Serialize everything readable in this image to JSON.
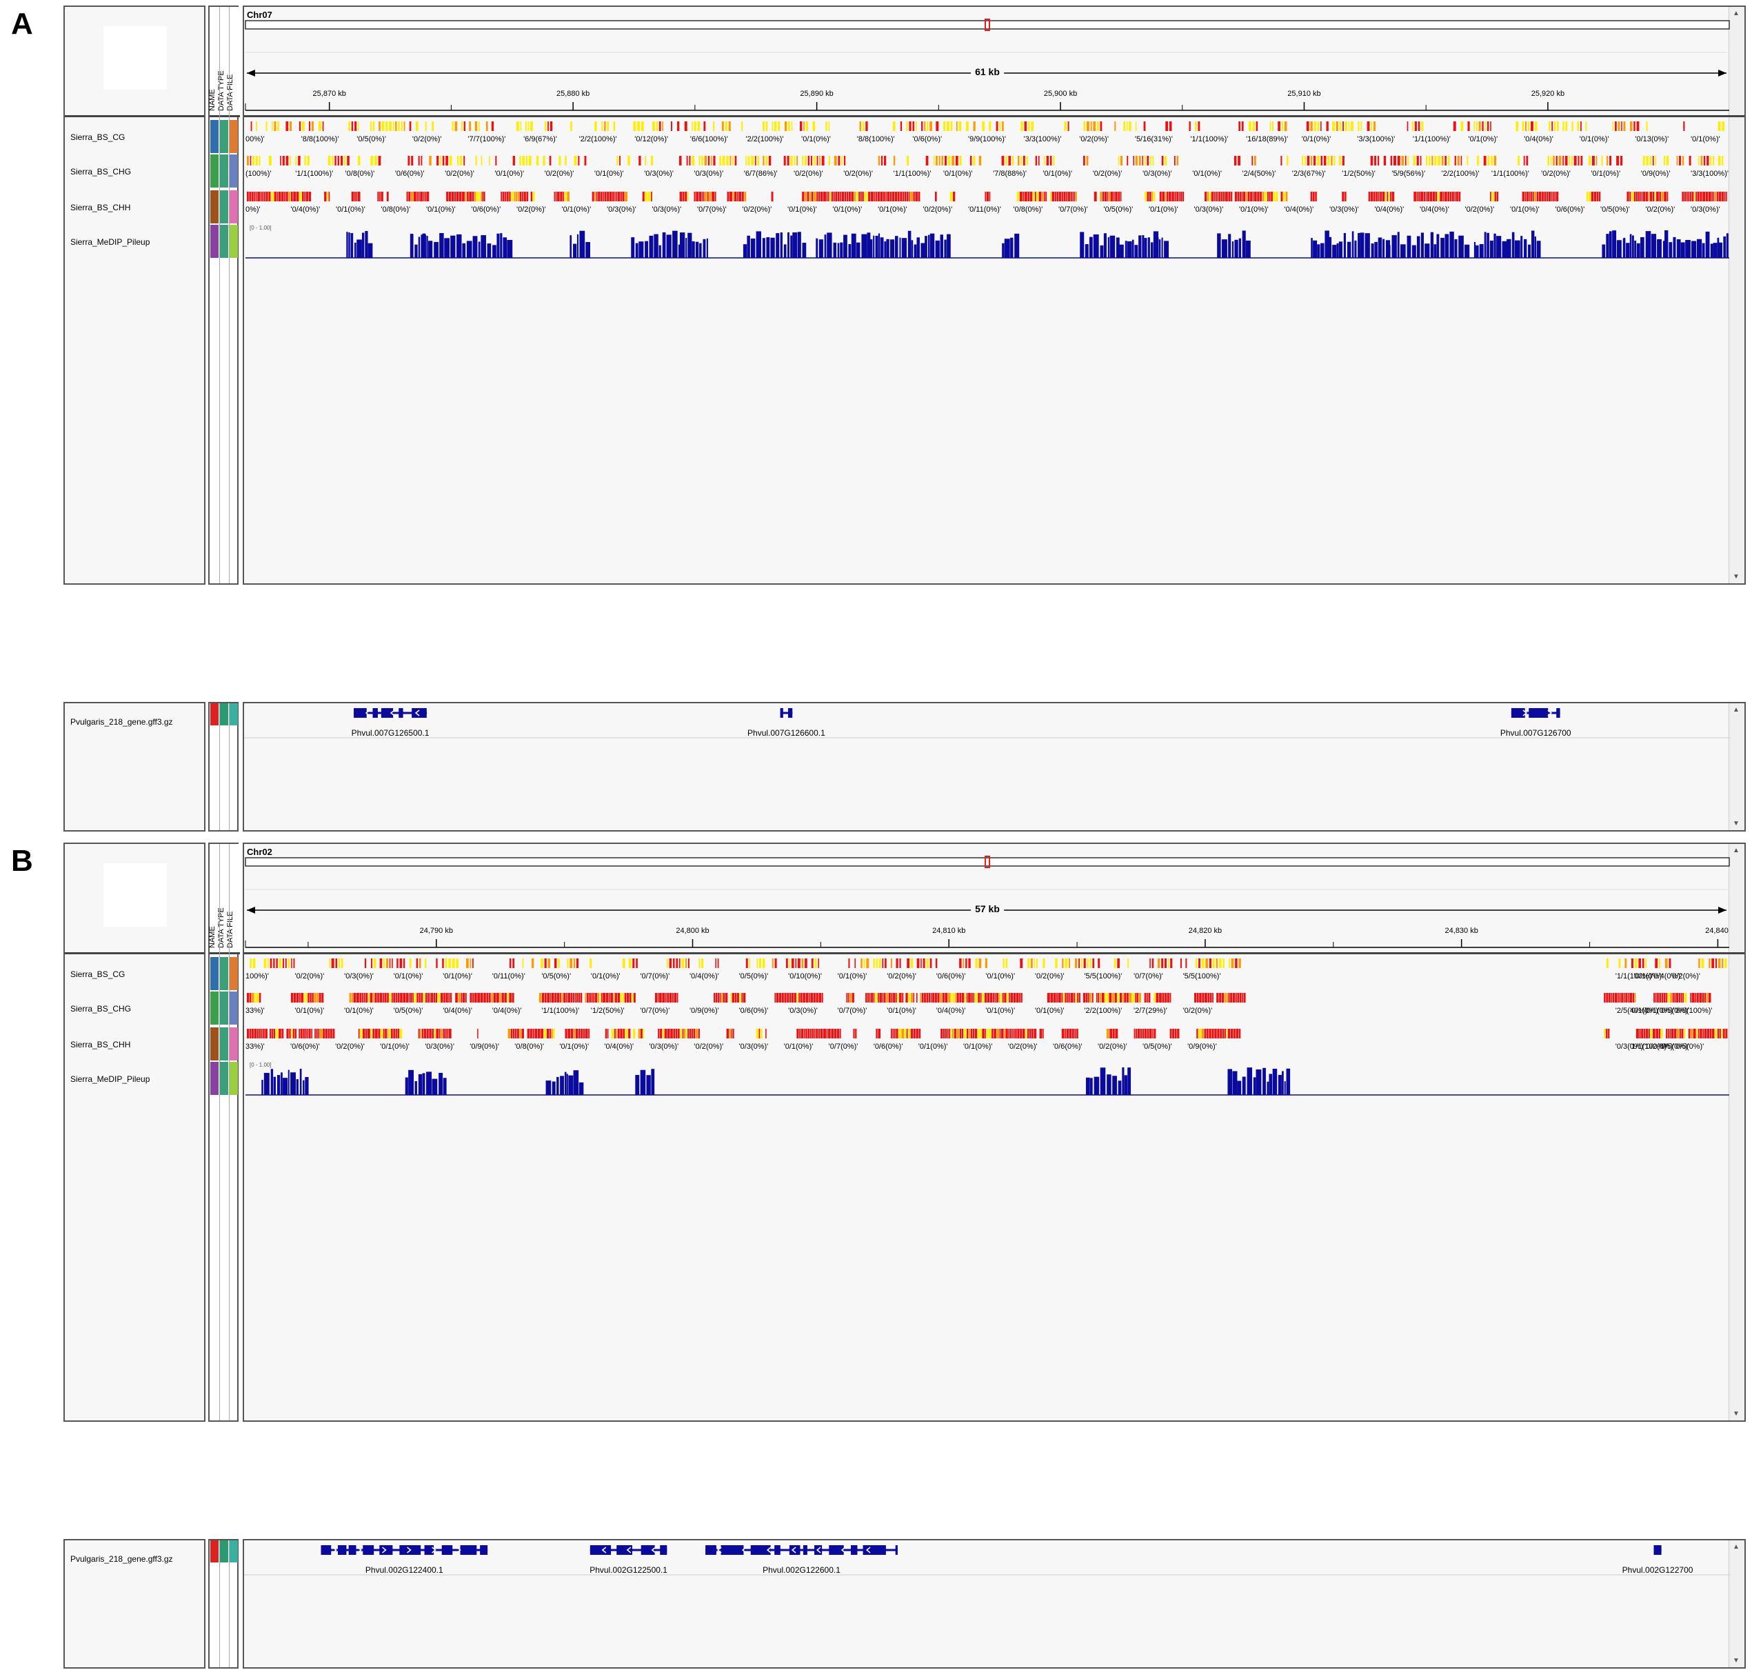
{
  "attr_headers": [
    "NAME",
    "DATA TYPE",
    "DATA FILE"
  ],
  "colors": {
    "meth_high": "#ee1111",
    "meth_mid": "#ff9900",
    "meth_low": "#ffee00",
    "pileup": "#0a0a9e",
    "gene": "#0a0a9e",
    "roi": "#e02020"
  },
  "panels": [
    {
      "letter": "A",
      "chromosome": "Chr07",
      "span_label": "61 kb",
      "range_kb": [
        25866.5,
        25927.5
      ],
      "roi_position_kb": 25897.0,
      "ticks": [
        {
          "kb": 25870,
          "label": "25,870 kb"
        },
        {
          "kb": 25880,
          "label": "25,880 kb"
        },
        {
          "kb": 25890,
          "label": "25,890 kb"
        },
        {
          "kb": 25900,
          "label": "25,900 kb"
        },
        {
          "kb": 25910,
          "label": "25,910 kb"
        },
        {
          "kb": 25920,
          "label": "25,920 kb"
        }
      ],
      "tracks": [
        {
          "name": "Sierra_BS_CG",
          "type": "meth",
          "attr_colors": [
            "#2f6fb0",
            "#3aa07a",
            "#e07a30"
          ],
          "dominant": "low",
          "annotations": [
            "00%)'",
            "'8/8(100%)'",
            "'0/5(0%)'",
            "'0/2(0%)'",
            "'7/7(100%)'",
            "'6/9(67%)'",
            "'2/2(100%)'",
            "'0/12(0%)'",
            "'6/6(100%)'",
            "'2/2(100%)'",
            "'0/1(0%)'",
            "'8/8(100%)'",
            "'0/6(0%)'",
            "'9/9(100%)'",
            "'3/3(100%)'",
            "'0/2(0%)'",
            "'5/16(31%)'",
            "'1/1(100%)'",
            "'16/18(89%)'",
            "'0/1(0%)'",
            "'3/3(100%)'",
            "'1/1(100%)'",
            "'0/1(0%)'",
            "'0/4(0%)'",
            "'0/1(0%)'",
            "'0/13(0%)'",
            "'0/1(0%)'"
          ]
        },
        {
          "name": "Sierra_BS_CHG",
          "type": "meth",
          "attr_colors": [
            "#3aa04a",
            "#3aa07a",
            "#6a80c0"
          ],
          "dominant": "mixed",
          "annotations": [
            "(100%)'",
            "'1/1(100%)'",
            "'0/8(0%)'",
            "'0/6(0%)'",
            "'0/2(0%)'",
            "'0/1(0%)'",
            "'0/2(0%)'",
            "'0/1(0%)'",
            "'0/3(0%)'",
            "'0/3(0%)'",
            "'6/7(86%)'",
            "'0/2(0%)'",
            "'0/2(0%)'",
            "'1/1(100%)'",
            "'0/1(0%)'",
            "'7/8(88%)'",
            "'0/1(0%)'",
            "'0/2(0%)'",
            "'0/3(0%)'",
            "'0/1(0%)'",
            "'2/4(50%)'",
            "'2/3(67%)'",
            "'1/2(50%)'",
            "'5/9(56%)'",
            "'2/2(100%)'",
            "'1/1(100%)'",
            "'0/2(0%)'",
            "'0/1(0%)'",
            "'0/9(0%)'",
            "'3/3(100%)'"
          ]
        },
        {
          "name": "Sierra_BS_CHH",
          "type": "meth",
          "attr_colors": [
            "#a0501a",
            "#3aa07a",
            "#e070b0"
          ],
          "dominant": "high",
          "annotations": [
            "0%)'",
            "'0/4(0%)'",
            "'0/1(0%)'",
            "'0/8(0%)'",
            "'0/1(0%)'",
            "'0/6(0%)'",
            "'0/2(0%)'",
            "'0/1(0%)'",
            "'0/3(0%)'",
            "'0/3(0%)'",
            "'0/7(0%)'",
            "'0/2(0%)'",
            "'0/1(0%)'",
            "'0/1(0%)'",
            "'0/1(0%)'",
            "'0/2(0%)'",
            "'0/11(0%)'",
            "'0/8(0%)'",
            "'0/7(0%)'",
            "'0/5(0%)'",
            "'0/1(0%)'",
            "'0/3(0%)'",
            "'0/1(0%)'",
            "'0/4(0%)'",
            "'0/3(0%)'",
            "'0/4(0%)'",
            "'0/4(0%)'",
            "'0/2(0%)'",
            "'0/1(0%)'",
            "'0/6(0%)'",
            "'0/5(0%)'",
            "'0/2(0%)'",
            "'0/3(0%)'"
          ]
        },
        {
          "name": "Sierra_MeDIP_Pileup",
          "type": "pileup",
          "attr_colors": [
            "#8a40a0",
            "#3aa07a",
            "#9ad040"
          ],
          "range_label": "[0 - 1.00]",
          "coverage": 0.55
        }
      ],
      "gene_track": {
        "name": "Pvulgaris_218_gene.gff3.gz",
        "attr_colors": [
          "#dd2020",
          "#2a9a70",
          "#3ab0a0"
        ],
        "genes": [
          {
            "label": "Phvul.007G126500.1",
            "start_kb": 25871.0,
            "end_kb": 25874.0,
            "strand": "-"
          },
          {
            "label": "Phvul.007G126600.1",
            "start_kb": 25888.5,
            "end_kb": 25889.0,
            "strand": "+"
          },
          {
            "label": "Phvul.007G126700",
            "start_kb": 25918.5,
            "end_kb": 25920.5,
            "strand": "+"
          }
        ]
      }
    },
    {
      "letter": "B",
      "chromosome": "Chr02",
      "span_label": "57 kb",
      "range_kb": [
        24782.5,
        24840.5
      ],
      "roi_position_kb": 24812.0,
      "ticks": [
        {
          "kb": 24790,
          "label": "24,790 kb"
        },
        {
          "kb": 24800,
          "label": "24,800 kb"
        },
        {
          "kb": 24810,
          "label": "24,810 kb"
        },
        {
          "kb": 24820,
          "label": "24,820 kb"
        },
        {
          "kb": 24830,
          "label": "24,830 kb"
        },
        {
          "kb": 24840,
          "label": "24,840"
        }
      ],
      "tracks": [
        {
          "name": "Sierra_BS_CG",
          "type": "meth",
          "attr_colors": [
            "#2f6fb0",
            "#3aa07a",
            "#e07a30"
          ],
          "dominant": "mixed",
          "annotations": [
            "100%)'",
            "'0/2(0%)'",
            "'0/3(0%)'",
            "'0/1(0%)'",
            "'0/1(0%)'",
            "'0/11(0%)'",
            "'0/5(0%)'",
            "'0/1(0%)'",
            "'0/7(0%)'",
            "'0/4(0%)'",
            "'0/5(0%)'",
            "'0/10(0%)'",
            "'0/1(0%)'",
            "'0/2(0%)'",
            "'0/6(0%)'",
            "'0/1(0%)'",
            "'0/2(0%)'",
            "'5/5(100%)'",
            "'0/7(0%)'",
            "'5/5(100%)'",
            "'1/1(100%)'",
            "'0/1(0%)'",
            "'0/4(0%)'",
            "'0/2(0%)'"
          ]
        },
        {
          "name": "Sierra_BS_CHG",
          "type": "meth",
          "attr_colors": [
            "#3aa04a",
            "#3aa07a",
            "#6a80c0"
          ],
          "dominant": "high",
          "annotations": [
            "33%)'",
            "'0/1(0%)'",
            "'0/1(0%)'",
            "'0/5(0%)'",
            "'0/4(0%)'",
            "'0/4(0%)'",
            "'1/1(100%)'",
            "'1/2(50%)'",
            "'0/7(0%)'",
            "'0/9(0%)'",
            "'0/6(0%)'",
            "'0/3(0%)'",
            "'0/7(0%)'",
            "'0/1(0%)'",
            "'0/4(0%)'",
            "'0/1(0%)'",
            "'0/1(0%)'",
            "'2/2(100%)'",
            "'2/7(29%)'",
            "'0/2(0%)'",
            "'2/5(40%)'",
            "'0/1(0%)'",
            "'0/1(0%)'",
            "'0/5(0%)'",
            "'8/8(100%)'"
          ]
        },
        {
          "name": "Sierra_BS_CHH",
          "type": "meth",
          "attr_colors": [
            "#a0501a",
            "#3aa07a",
            "#e070b0"
          ],
          "dominant": "high",
          "annotations": [
            "33%)'",
            "'0/6(0%)'",
            "'0/2(0%)'",
            "'0/1(0%)'",
            "'0/3(0%)'",
            "'0/9(0%)'",
            "'0/8(0%)'",
            "'0/1(0%)'",
            "'0/4(0%)'",
            "'0/3(0%)'",
            "'0/2(0%)'",
            "'0/3(0%)'",
            "'0/1(0%)'",
            "'0/7(0%)'",
            "'0/6(0%)'",
            "'0/1(0%)'",
            "'0/1(0%)'",
            "'0/2(0%)'",
            "'0/6(0%)'",
            "'0/2(0%)'",
            "'0/5(0%)'",
            "'0/9(0%)'",
            "'0/3(0%)'",
            "'1/1(100%)'",
            "'0/2(0%)'",
            "'0/5(0%)'",
            "'0/5(0%)'"
          ]
        },
        {
          "name": "Sierra_MeDIP_Pileup",
          "type": "pileup",
          "attr_colors": [
            "#8a40a0",
            "#3aa07a",
            "#9ad040"
          ],
          "range_label": "[0 - 1.00]",
          "coverage": 0.22
        }
      ],
      "gene_track": {
        "name": "Pvulgaris_218_gene.gff3.gz",
        "attr_colors": [
          "#dd2020",
          "#2a9a70",
          "#3ab0a0"
        ],
        "genes": [
          {
            "label": "Phvul.002G122400.1",
            "start_kb": 24785.5,
            "end_kb": 24792.0,
            "strand": "+"
          },
          {
            "label": "Phvul.002G122500.1",
            "start_kb": 24796.0,
            "end_kb": 24799.0,
            "strand": "-"
          },
          {
            "label": "Phvul.002G122600.1",
            "start_kb": 24800.5,
            "end_kb": 24808.0,
            "strand": "-"
          },
          {
            "label": "Phvul.002G122700",
            "start_kb": 24837.5,
            "end_kb": 24837.8,
            "strand": "+"
          }
        ]
      }
    }
  ]
}
